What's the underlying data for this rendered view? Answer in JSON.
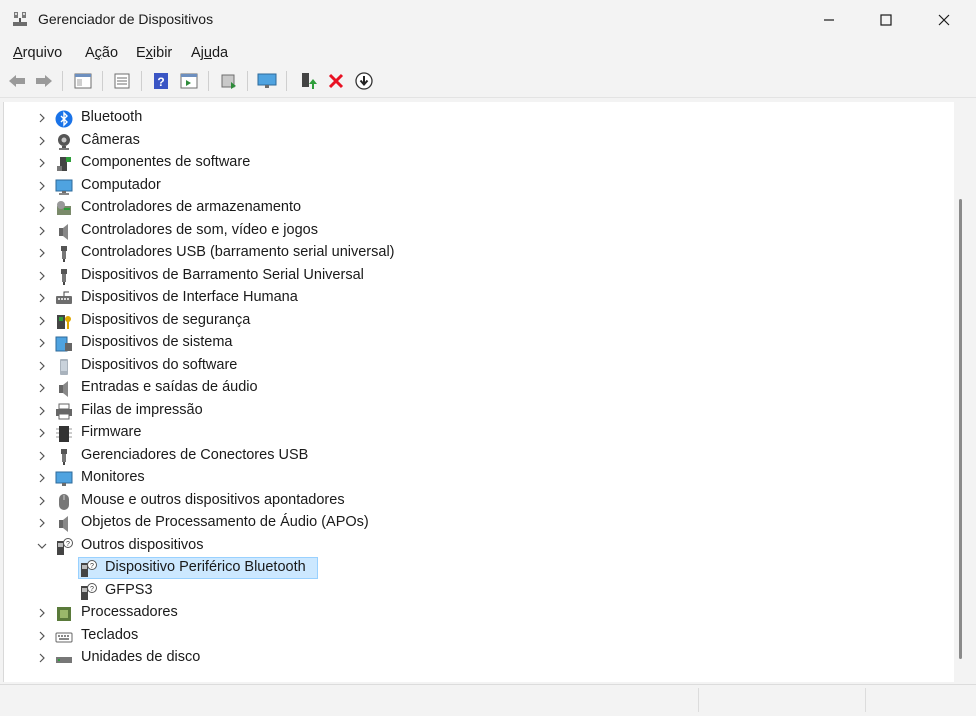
{
  "window": {
    "title": "Gerenciador de Dispositivos"
  },
  "menu": [
    {
      "pre": "",
      "u": "A",
      "post": "rquivo"
    },
    {
      "pre": "A",
      "u": "ç",
      "post": "ão"
    },
    {
      "pre": "E",
      "u": "x",
      "post": "ibir"
    },
    {
      "pre": "Aj",
      "u": "u",
      "post": "da"
    }
  ],
  "tree": {
    "items": [
      {
        "label": "Bluetooth",
        "icon": "bluetooth-icon"
      },
      {
        "label": "Câmeras",
        "icon": "camera-icon"
      },
      {
        "label": "Componentes de software",
        "icon": "software-component-icon"
      },
      {
        "label": "Computador",
        "icon": "computer-icon"
      },
      {
        "label": "Controladores de armazenamento",
        "icon": "storage-controller-icon"
      },
      {
        "label": "Controladores de som, vídeo e jogos",
        "icon": "speaker-icon"
      },
      {
        "label": "Controladores USB (barramento serial universal)",
        "icon": "usb-icon"
      },
      {
        "label": "Dispositivos de Barramento Serial Universal",
        "icon": "usb-icon"
      },
      {
        "label": "Dispositivos de Interface Humana",
        "icon": "hid-icon"
      },
      {
        "label": "Dispositivos de segurança",
        "icon": "security-key-icon"
      },
      {
        "label": "Dispositivos de sistema",
        "icon": "system-device-icon"
      },
      {
        "label": "Dispositivos do software",
        "icon": "software-device-icon"
      },
      {
        "label": "Entradas e saídas de áudio",
        "icon": "speaker-icon"
      },
      {
        "label": "Filas de impressão",
        "icon": "printer-icon"
      },
      {
        "label": "Firmware",
        "icon": "firmware-chip-icon"
      },
      {
        "label": "Gerenciadores de Conectores USB",
        "icon": "usb-icon"
      },
      {
        "label": "Monitores",
        "icon": "monitor-icon"
      },
      {
        "label": "Mouse e outros dispositivos apontadores",
        "icon": "mouse-icon"
      },
      {
        "label": "Objetos de Processamento de Áudio (APOs)",
        "icon": "speaker-icon"
      },
      {
        "label": "Outros dispositivos",
        "icon": "unknown-device-icon",
        "expanded": true
      },
      {
        "label": "Dispositivo Periférico Bluetooth",
        "icon": "unknown-device-icon",
        "child": true,
        "selected": true
      },
      {
        "label": "GFPS3",
        "icon": "unknown-device-icon",
        "child": true
      },
      {
        "label": "Processadores",
        "icon": "processor-icon"
      },
      {
        "label": "Teclados",
        "icon": "keyboard-icon"
      },
      {
        "label": "Unidades de disco",
        "icon": "disk-drive-icon"
      }
    ]
  },
  "colors": {
    "selection": "#cce8ff",
    "selection_border": "#99d1ff",
    "remove_red": "#e81123"
  }
}
